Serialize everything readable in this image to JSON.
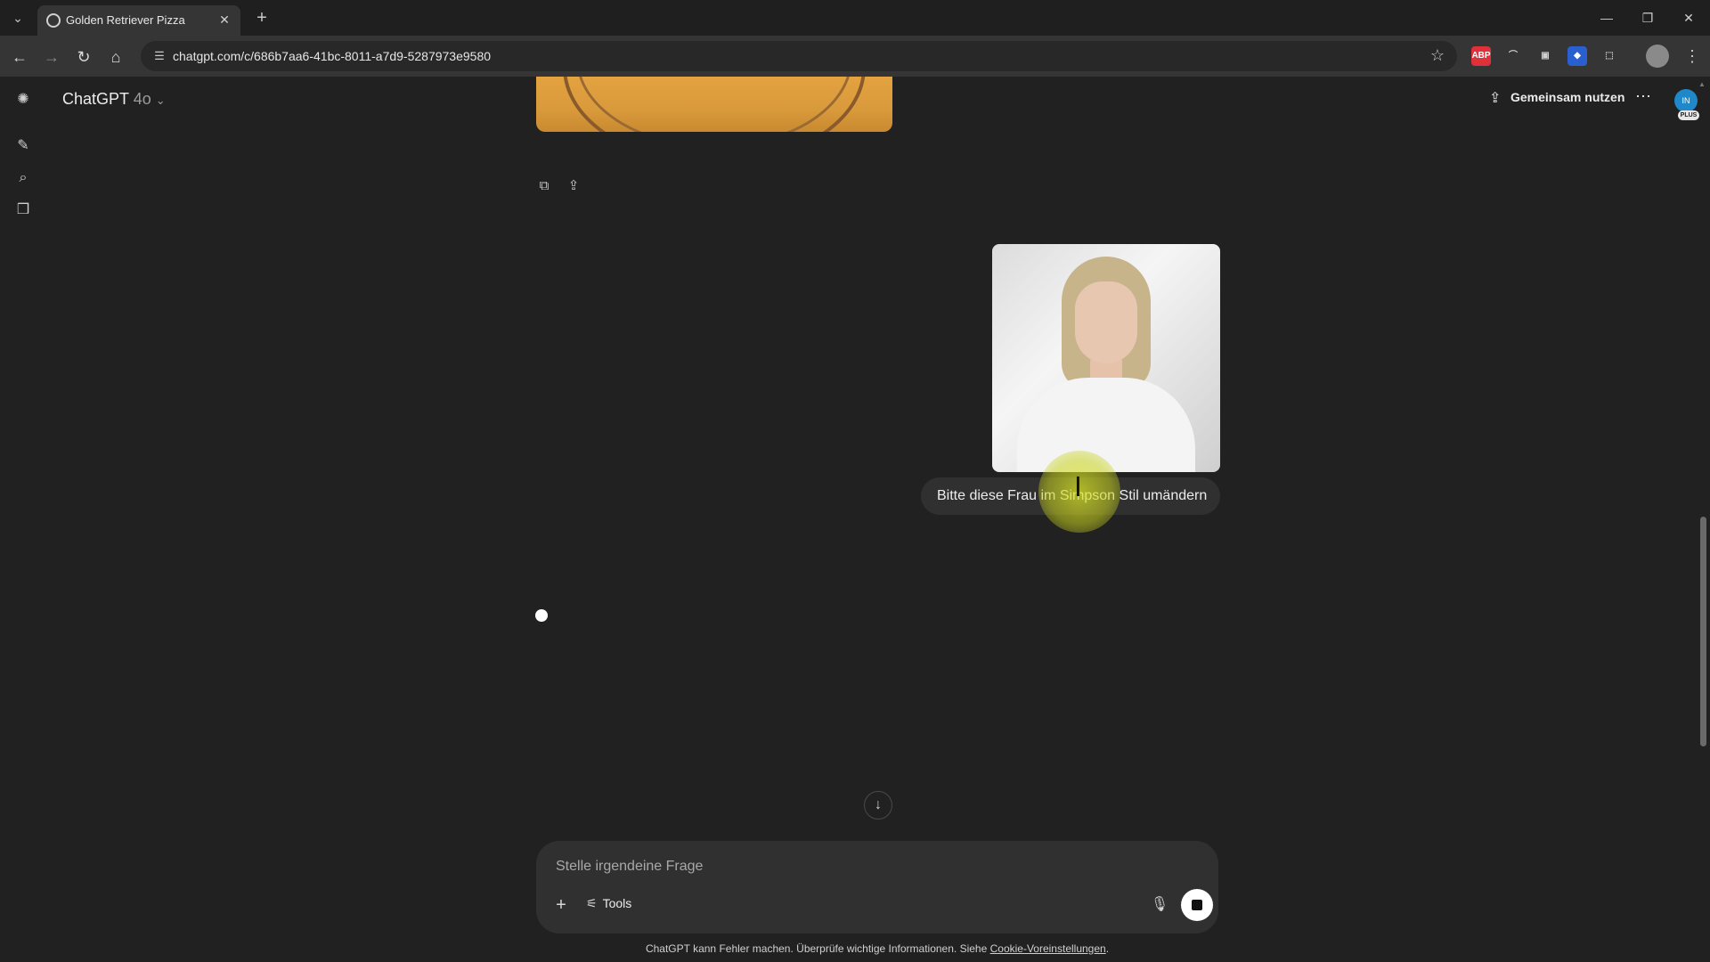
{
  "browser": {
    "tab_title": "Golden Retriever Pizza",
    "tab_close": "✕",
    "new_tab": "+",
    "url": "chatgpt.com/c/686b7aa6-41bc-8011-a7d9-5287973e9580",
    "window_controls": {
      "minimize": "—",
      "maximize": "❐",
      "close": "✕"
    },
    "extensions": [
      {
        "name": "abp-icon",
        "label": "ABP",
        "color": "#e0303a"
      },
      {
        "name": "extension-arc-icon",
        "label": "⌒",
        "color": "#3a3a3a"
      },
      {
        "name": "camera-icon",
        "label": "▣",
        "color": "#3a3a3a"
      },
      {
        "name": "bitwarden-icon",
        "label": "◆",
        "color": "#2a5fd0"
      },
      {
        "name": "puzzle-icon",
        "label": "⬚",
        "color": "#3a3a3a"
      }
    ]
  },
  "app": {
    "model_name": "ChatGPT",
    "model_version": "4o",
    "share_label": "Gemeinsam nutzen",
    "avatar_initials": "IN",
    "plus_badge": "PLUS"
  },
  "conversation": {
    "user_message": "Bitte diese Frau im Simpson Stil umändern"
  },
  "composer": {
    "placeholder": "Stelle irgendeine Frage",
    "tools_label": "Tools"
  },
  "footer": {
    "text": "ChatGPT kann Fehler machen. Überprüfe wichtige Informationen. Siehe ",
    "link": "Cookie-Voreinstellungen",
    "end": "."
  }
}
